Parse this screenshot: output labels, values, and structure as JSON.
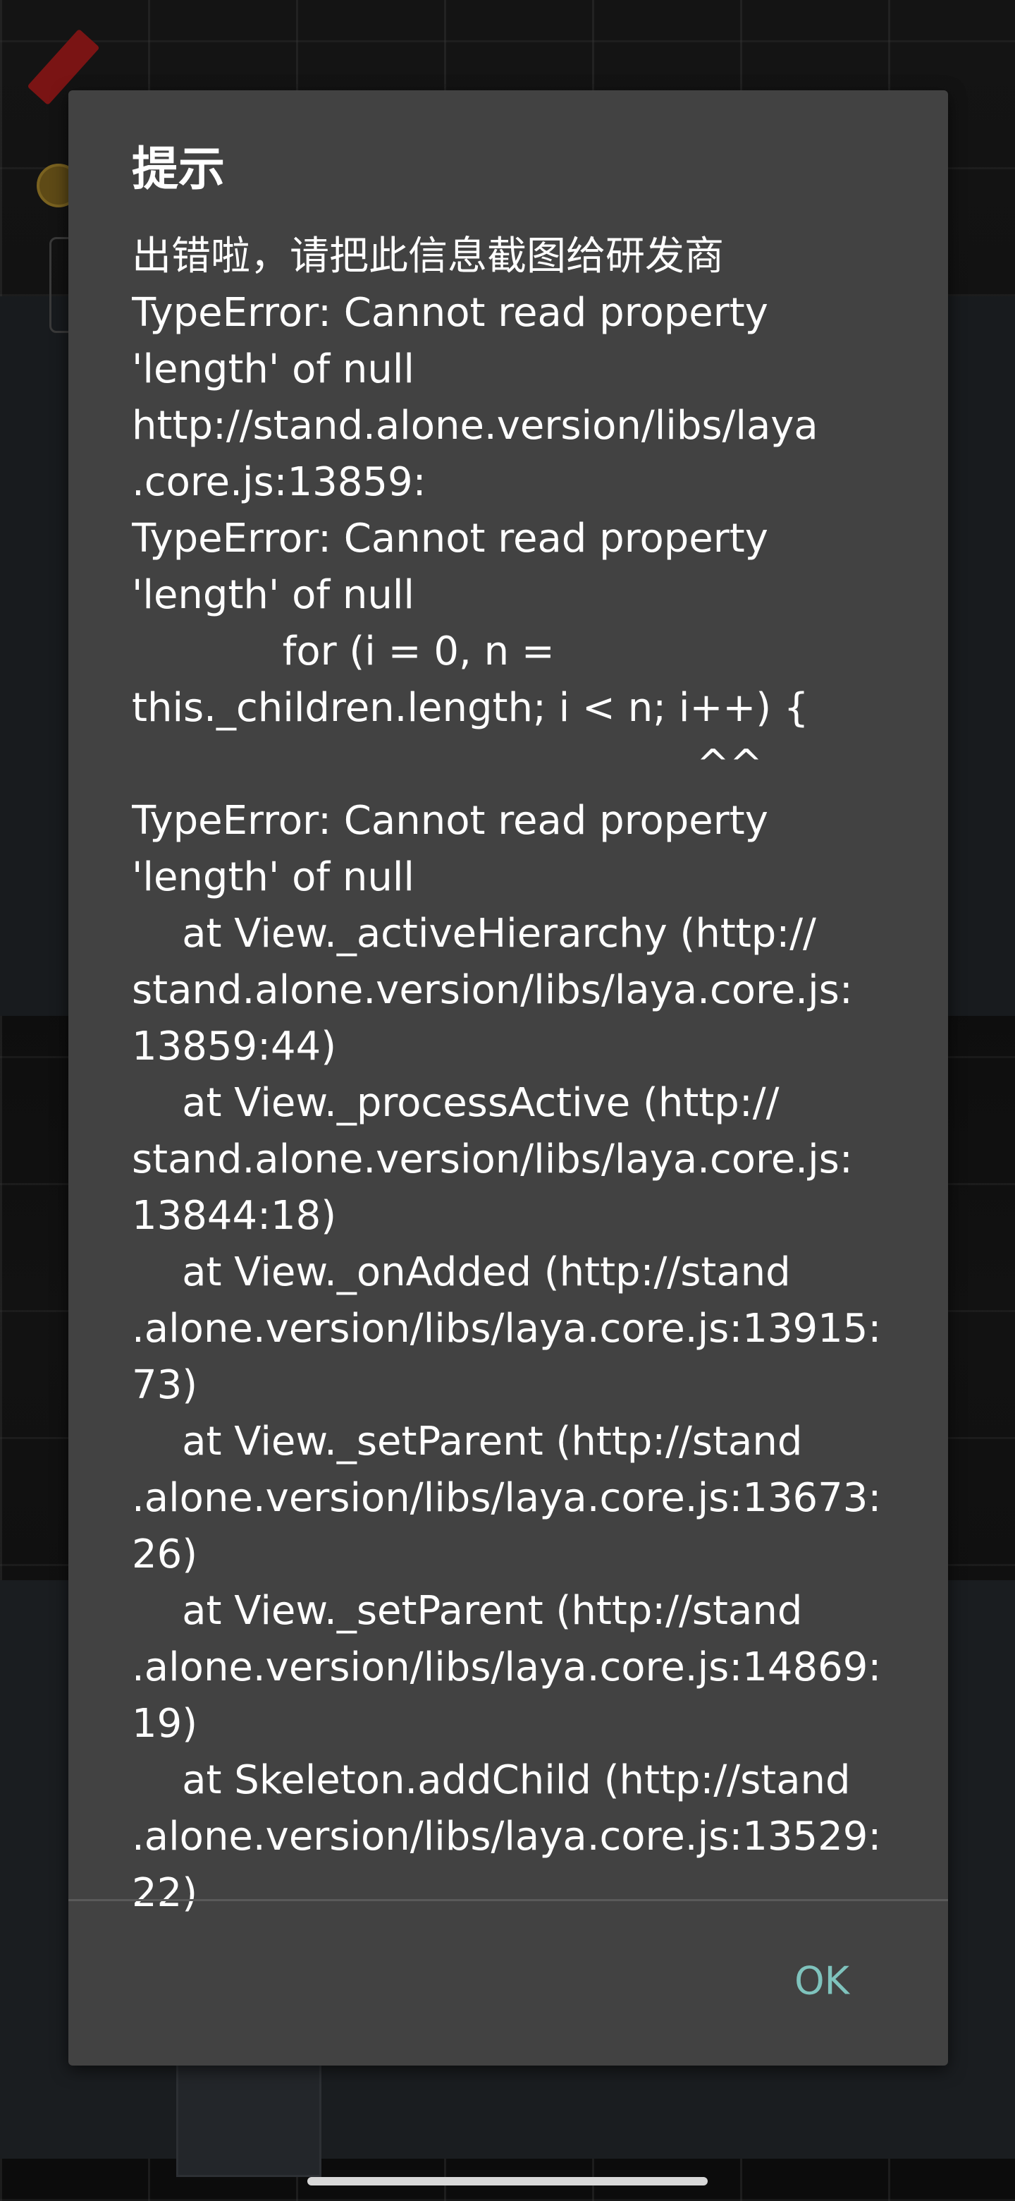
{
  "dialog": {
    "title": "提示",
    "message": "出错啦，请把此信息截图给研发商\nTypeError: Cannot read property\n'length' of null\nhttp://stand.alone.version/libs/laya\n.core.js:13859:\nTypeError: Cannot read property\n'length' of null\n            for (i = 0, n =\nthis._children.length; i < n; i++) {\n                                             ^^\nTypeError: Cannot read property\n'length' of null\n    at View._activeHierarchy (http://\nstand.alone.version/libs/laya.core.js:\n13859:44)\n    at View._processActive (http://\nstand.alone.version/libs/laya.core.js:\n13844:18)\n    at View._onAdded (http://stand\n.alone.version/libs/laya.core.js:13915:\n73)\n    at View._setParent (http://stand\n.alone.version/libs/laya.core.js:13673:\n26)\n    at View._setParent (http://stand\n.alone.version/libs/laya.core.js:14869:\n19)\n    at Skeleton.addChild (http://stand\n.alone.version/libs/laya.core.js:13529:\n22)",
    "ok_label": "OK",
    "ok_color": "#7fc3bd",
    "background_color": "#424242"
  },
  "icons": {
    "flag": "red-flag-icon",
    "coin": "coin-icon"
  }
}
